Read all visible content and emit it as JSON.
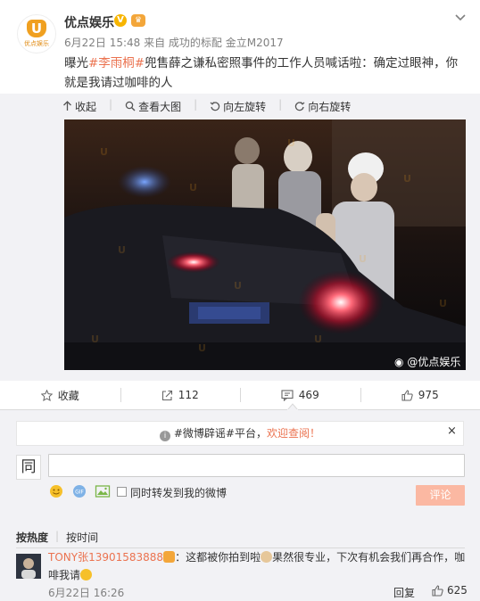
{
  "post": {
    "author": "优点娱乐",
    "avatar_text": "优点娱乐",
    "avatar_letter": "U",
    "verified_badge": "V",
    "meta": "6月22日 15:48 来自 成功的标配 金立M2017",
    "text_parts": [
      "曝光",
      "#李雨桐#",
      "兜售薛之谦私密照事件的工作人员喊话啦：确定过眼神，你就是我请过咖啡的人"
    ],
    "highlight_color": "#eb7350"
  },
  "media_toolbar": {
    "collapse": "收起",
    "view_large": "查看大图",
    "rotate_left": "向左旋转",
    "rotate_right": "向右旋转"
  },
  "photo": {
    "watermark": "@优点娱乐",
    "pattern_text": "优点娱乐"
  },
  "actions": {
    "favorite": "收藏",
    "repost": "112",
    "comment": "469",
    "like": "975"
  },
  "comment_box": {
    "notice_prefix": "#微博辟谣#平台，",
    "notice_link": "欢迎查阅！",
    "notice_close": "×",
    "my_avatar_glyph": "同",
    "input_value": "",
    "also_repost_label": "同时转发到我的微博",
    "submit_label": "评论",
    "submit_color": "#fbb8a2"
  },
  "sort_tabs": [
    "按热度",
    "按时间"
  ],
  "comments": [
    {
      "user": "TONY张13901583888",
      "text_1": "：这都被你拍到啦",
      "text_2": "果然很专业，下次有机会我们再合作，咖啡我请",
      "date": "6月22日 16:26",
      "reply_label": "回复",
      "likes": "625"
    }
  ]
}
